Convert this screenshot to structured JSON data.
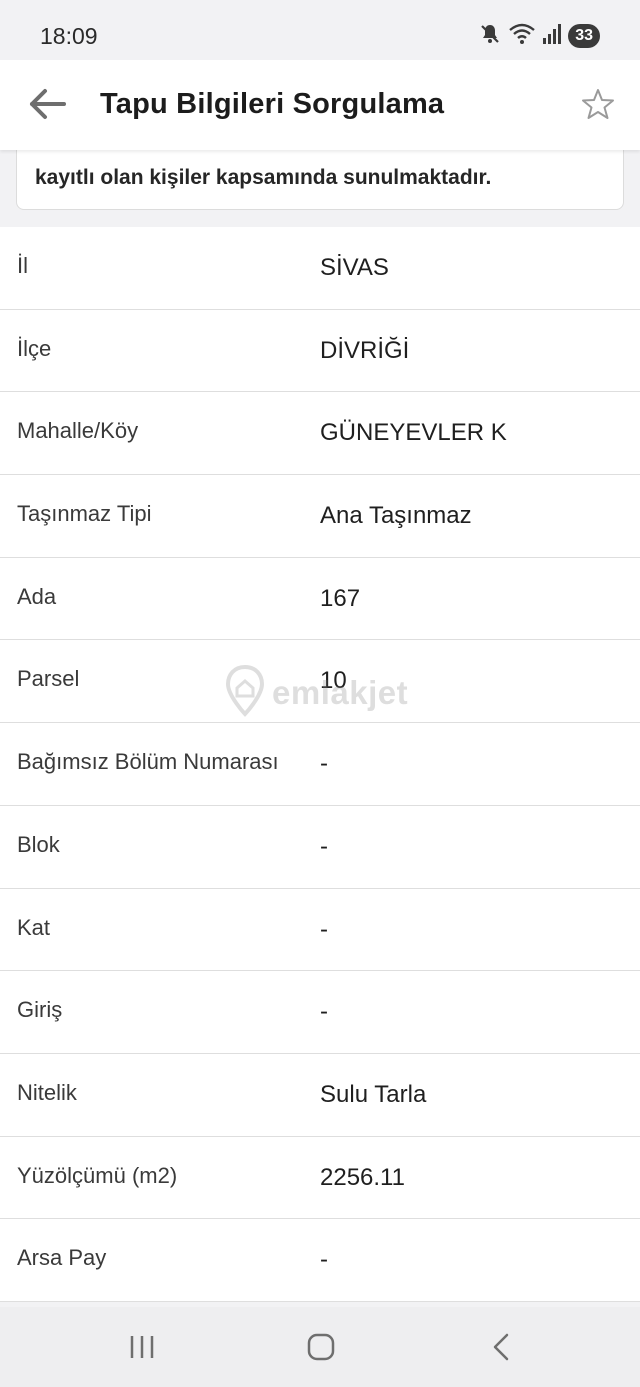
{
  "status_bar": {
    "time": "18:09",
    "battery": "33",
    "icons": [
      "mute-icon",
      "wifi-icon",
      "signal-icon",
      "battery-icon"
    ]
  },
  "app_bar": {
    "title": "Tapu Bilgileri Sorgulama",
    "back_icon": "arrow-left-icon",
    "favorite_icon": "star-outline-icon"
  },
  "notice": {
    "text": "kayıtlı olan kişiler kapsamında sunulmaktadır."
  },
  "details": [
    {
      "label": "İl",
      "value": "SİVAS"
    },
    {
      "label": "İlçe",
      "value": "DİVRİĞİ"
    },
    {
      "label": "Mahalle/Köy",
      "value": "GÜNEYEVLER K"
    },
    {
      "label": "Taşınmaz Tipi",
      "value": "Ana Taşınmaz"
    },
    {
      "label": "Ada",
      "value": "167"
    },
    {
      "label": "Parsel",
      "value": "10"
    },
    {
      "label": "Bağımsız Bölüm Numarası",
      "value": "-"
    },
    {
      "label": "Blok",
      "value": "-"
    },
    {
      "label": "Kat",
      "value": "-"
    },
    {
      "label": "Giriş",
      "value": "-"
    },
    {
      "label": "Nitelik",
      "value": "Sulu Tarla"
    },
    {
      "label": "Yüzölçümü (m2)",
      "value": "2256.11"
    },
    {
      "label": "Arsa Pay",
      "value": "-"
    }
  ],
  "watermark": {
    "text": "emlakjet"
  },
  "nav_bar": {
    "icons": [
      "recent-apps-icon",
      "home-icon",
      "back-nav-icon"
    ]
  },
  "colors": {
    "background": "#f2f2f4",
    "surface": "#ffffff",
    "divider": "#dedede",
    "text_primary": "#1f1f1f",
    "icon_gray": "#8a8a8a"
  }
}
